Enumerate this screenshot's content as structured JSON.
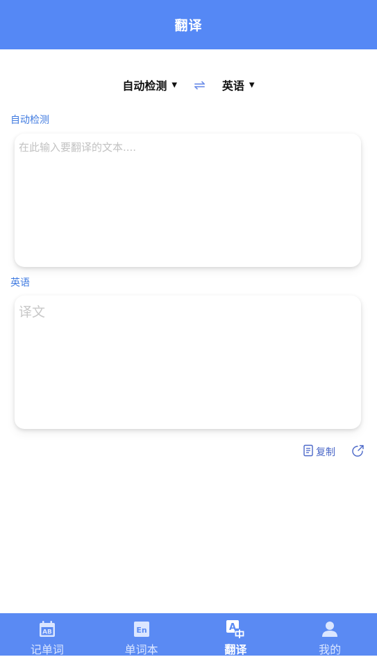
{
  "header": {
    "title": "翻译"
  },
  "lang_bar": {
    "source_lang": "自动检测",
    "target_lang": "英语",
    "swap_icon": "⇌",
    "caret": "▼"
  },
  "source": {
    "label": "自动检测",
    "placeholder": "在此输入要翻译的文本...."
  },
  "target": {
    "label": "英语",
    "placeholder": "译文"
  },
  "actions": {
    "copy_label": "复制",
    "copy_icon": "document-copy-icon",
    "share_icon": "share-icon"
  },
  "tabbar": {
    "tabs": [
      {
        "label": "记单词",
        "icon": "calendar-ab-icon",
        "active": false
      },
      {
        "label": "单词本",
        "icon": "en-book-icon",
        "active": false
      },
      {
        "label": "翻译",
        "icon": "translate-icon",
        "active": true
      },
      {
        "label": "我的",
        "icon": "user-icon",
        "active": false
      }
    ],
    "colors": {
      "bar": "#5a8af3",
      "active": "#ffffff",
      "inactive": "#dbe6ff"
    }
  },
  "colors": {
    "header": "#5588f5",
    "label": "#3f7ae0",
    "accent": "#4a67c8"
  }
}
